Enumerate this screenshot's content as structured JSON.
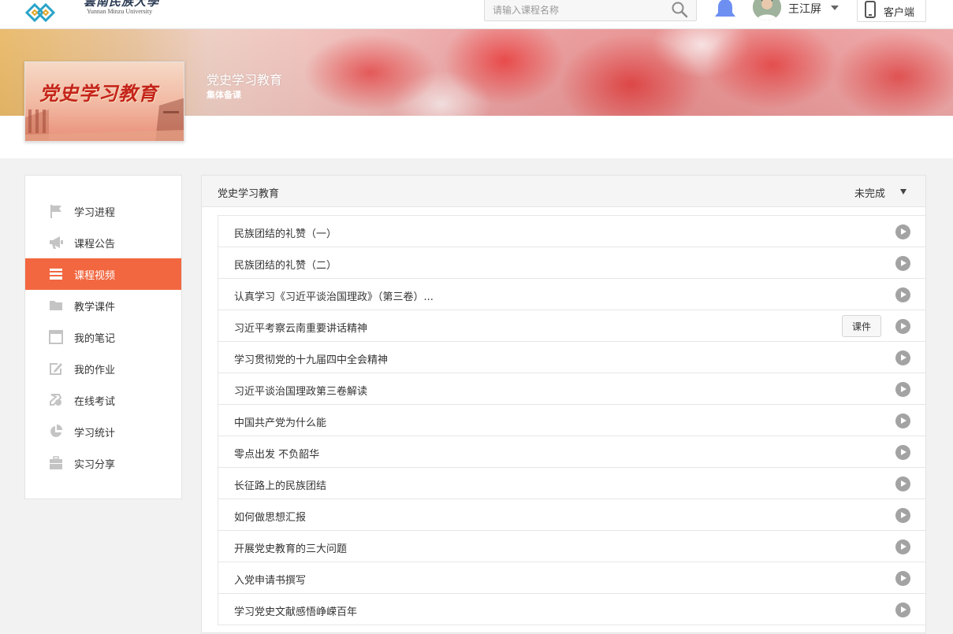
{
  "header": {
    "logo_text": "雲南民族大學",
    "logo_sub": "Yunnan Minzu University",
    "search_placeholder": "请输入课程名称",
    "username": "王江屏",
    "client_label": "客户端"
  },
  "course": {
    "name": "党史学习教育",
    "type": "集体备课",
    "cover_text": "党史学习教育"
  },
  "sidebar": {
    "items": [
      {
        "label": "学习进程",
        "icon": "flag-icon"
      },
      {
        "label": "课程公告",
        "icon": "megaphone-icon"
      },
      {
        "label": "课程视频",
        "icon": "video-list-icon",
        "active": true
      },
      {
        "label": "教学课件",
        "icon": "folder-icon"
      },
      {
        "label": "我的笔记",
        "icon": "notebook-icon"
      },
      {
        "label": "我的作业",
        "icon": "edit-icon"
      },
      {
        "label": "在线考试",
        "icon": "exam-icon"
      },
      {
        "label": "学习统计",
        "icon": "pie-chart-icon"
      },
      {
        "label": "实习分享",
        "icon": "briefcase-icon"
      }
    ]
  },
  "panel": {
    "title": "党史学习教育",
    "status": "未完成",
    "courseware_label": "课件",
    "lessons": [
      {
        "title": "民族团结的礼赞（一）"
      },
      {
        "title": "民族团结的礼赞（二）"
      },
      {
        "title": "认真学习《习近平谈治国理政》（第三卷）..."
      },
      {
        "title": "习近平考察云南重要讲话精神",
        "has_courseware": true
      },
      {
        "title": "学习贯彻党的十九届四中全会精神"
      },
      {
        "title": "习近平谈治国理政第三卷解读"
      },
      {
        "title": "中国共产党为什么能"
      },
      {
        "title": "零点出发 不负韶华"
      },
      {
        "title": "长征路上的民族团结"
      },
      {
        "title": "如何做思想汇报"
      },
      {
        "title": "开展党史教育的三大问题"
      },
      {
        "title": "入党申请书撰写"
      },
      {
        "title": "学习党史文献感悟峥嵘百年"
      }
    ]
  },
  "colors": {
    "accent": "#f26740",
    "icon_gray": "#a3a3a3",
    "bell": "#6d8ff2"
  }
}
